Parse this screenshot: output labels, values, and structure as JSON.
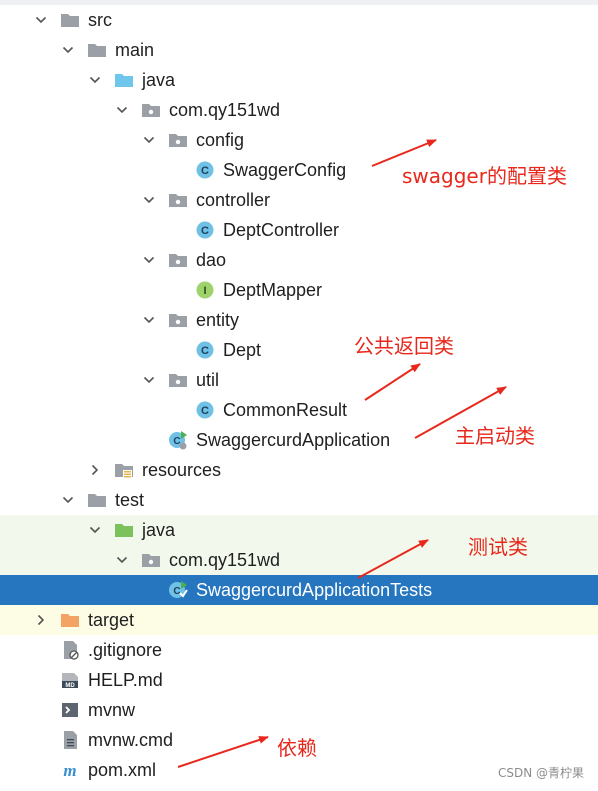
{
  "tree": [
    {
      "label": "src",
      "depth": 0,
      "expand": "open",
      "icon": "folder-icon"
    },
    {
      "label": "main",
      "depth": 1,
      "expand": "open",
      "icon": "folder-icon"
    },
    {
      "label": "java",
      "depth": 2,
      "expand": "open",
      "icon": "source-folder-icon"
    },
    {
      "label": "com.qy151wd",
      "depth": 3,
      "expand": "open",
      "icon": "package-icon"
    },
    {
      "label": "config",
      "depth": 4,
      "expand": "open",
      "icon": "package-icon"
    },
    {
      "label": "SwaggerConfig",
      "depth": 5,
      "expand": "none",
      "icon": "java-class-icon"
    },
    {
      "label": "controller",
      "depth": 4,
      "expand": "open",
      "icon": "package-icon"
    },
    {
      "label": "DeptController",
      "depth": 5,
      "expand": "none",
      "icon": "java-class-icon"
    },
    {
      "label": "dao",
      "depth": 4,
      "expand": "open",
      "icon": "package-icon"
    },
    {
      "label": "DeptMapper",
      "depth": 5,
      "expand": "none",
      "icon": "java-interface-icon"
    },
    {
      "label": "entity",
      "depth": 4,
      "expand": "open",
      "icon": "package-icon"
    },
    {
      "label": "Dept",
      "depth": 5,
      "expand": "none",
      "icon": "java-class-icon"
    },
    {
      "label": "util",
      "depth": 4,
      "expand": "open",
      "icon": "package-icon"
    },
    {
      "label": "CommonResult",
      "depth": 5,
      "expand": "none",
      "icon": "java-class-icon"
    },
    {
      "label": "SwaggercurdApplication",
      "depth": 4,
      "expand": "none",
      "icon": "spring-boot-class-icon"
    },
    {
      "label": "resources",
      "depth": 2,
      "expand": "closed",
      "icon": "resources-folder-icon"
    },
    {
      "label": "test",
      "depth": 1,
      "expand": "open",
      "icon": "folder-icon"
    },
    {
      "label": "java",
      "depth": 2,
      "expand": "open",
      "icon": "test-folder-icon"
    },
    {
      "label": "com.qy151wd",
      "depth": 3,
      "expand": "open",
      "icon": "package-icon"
    },
    {
      "label": "SwaggercurdApplicationTests",
      "depth": 4,
      "expand": "none",
      "icon": "spring-boot-test-class-icon",
      "selected": true
    },
    {
      "label": "target",
      "depth": 0,
      "expand": "closed",
      "icon": "excluded-folder-icon"
    },
    {
      "label": ".gitignore",
      "depth": 0,
      "expand": "none",
      "icon": "gitignore-file-icon"
    },
    {
      "label": "HELP.md",
      "depth": 0,
      "expand": "none",
      "icon": "markdown-file-icon"
    },
    {
      "label": "mvnw",
      "depth": 0,
      "expand": "none",
      "icon": "shell-script-icon"
    },
    {
      "label": "mvnw.cmd",
      "depth": 0,
      "expand": "none",
      "icon": "text-file-icon"
    },
    {
      "label": "pom.xml",
      "depth": 0,
      "expand": "none",
      "icon": "maven-file-icon"
    }
  ],
  "annotations": {
    "swagger_config": "swagger的配置类",
    "common_result": "公共返回类",
    "main_class": "主启动类",
    "test_class": "测试类",
    "dependencies": "依赖"
  },
  "watermark": "CSDN @青柠果",
  "colors": {
    "selection": "#2675bf",
    "test_band": "#f2f9ec",
    "excluded_band": "#fdfde6",
    "annotation": "#e8281c"
  }
}
